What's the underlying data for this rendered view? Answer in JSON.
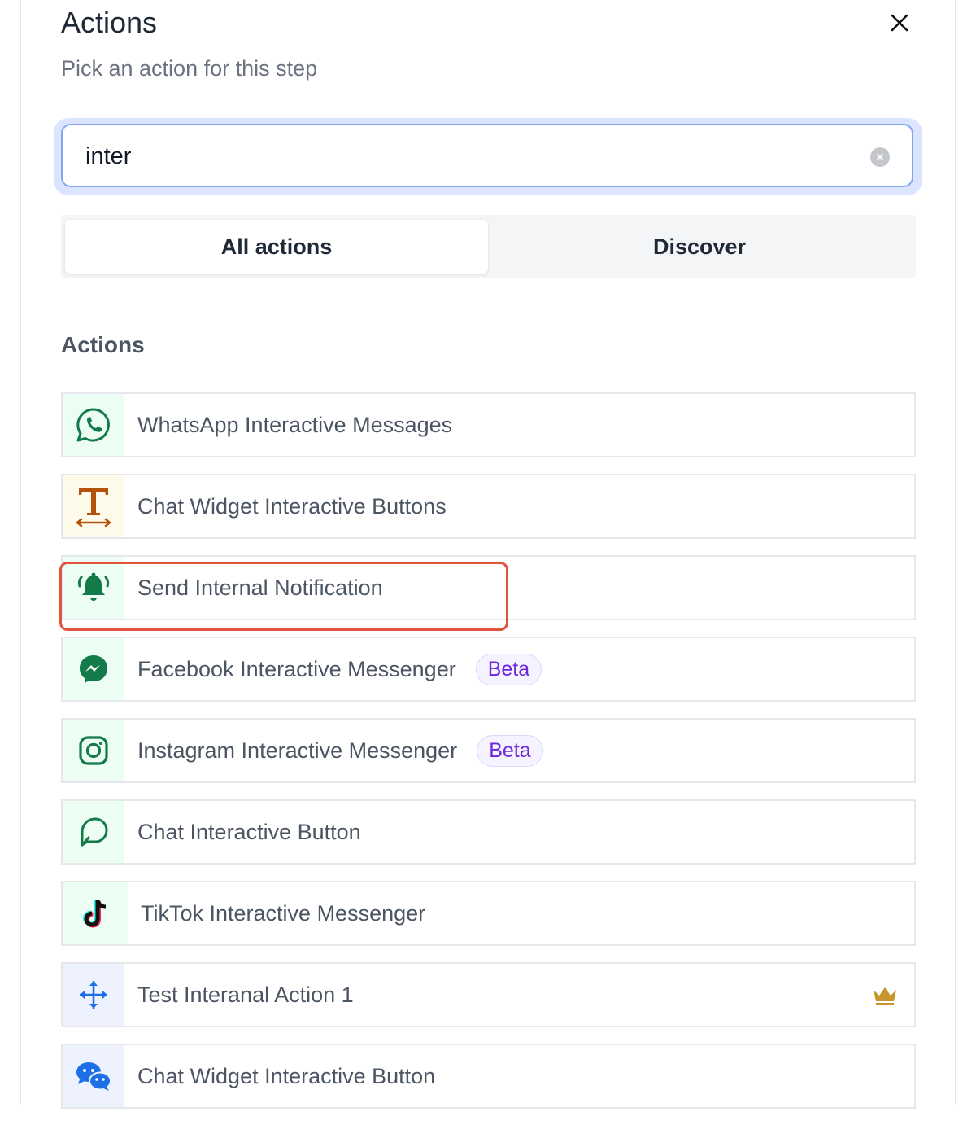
{
  "header": {
    "title": "Actions",
    "subtitle": "Pick an action for this step"
  },
  "search": {
    "value": "inter"
  },
  "tabs": [
    {
      "label": "All actions",
      "active": true
    },
    {
      "label": "Discover",
      "active": false
    }
  ],
  "section": {
    "label": "Actions"
  },
  "items": [
    {
      "label": "WhatsApp Interactive Messages",
      "icon": "whatsapp-icon",
      "icon_bg": "#ecfdf3"
    },
    {
      "label": "Chat Widget Interactive Buttons",
      "icon": "text-resize-icon",
      "icon_bg": "#fffbeb"
    },
    {
      "label": "Send Internal Notification",
      "icon": "bell-ringing-icon",
      "icon_bg": "#ecfdf3",
      "highlighted": true
    },
    {
      "label": "Facebook Interactive Messenger",
      "icon": "messenger-icon",
      "icon_bg": "#ecfdf3",
      "badge": "Beta"
    },
    {
      "label": "Instagram Interactive Messenger",
      "icon": "instagram-icon",
      "icon_bg": "#ecfdf3",
      "badge": "Beta"
    },
    {
      "label": "Chat Interactive Button",
      "icon": "chat-bubble-icon",
      "icon_bg": "#ecfdf3"
    },
    {
      "label": "TikTok Interactive Messenger",
      "icon": "tiktok-icon",
      "icon_bg": "#ecfdf3"
    },
    {
      "label": "Test Interanal Action 1",
      "icon": "move-arrows-icon",
      "icon_bg": "#eef2ff",
      "premium": "crown-icon"
    },
    {
      "label": "Chat Widget Interactive Button",
      "icon": "wechat-icon",
      "icon_bg": "#eef2ff"
    }
  ],
  "colors": {
    "accent_green": "#137a4a",
    "highlight_red": "#e0533d",
    "beta_purple": "#6d28d9",
    "crown_gold": "#c9962d",
    "blue_icon": "#1d6fe8"
  }
}
